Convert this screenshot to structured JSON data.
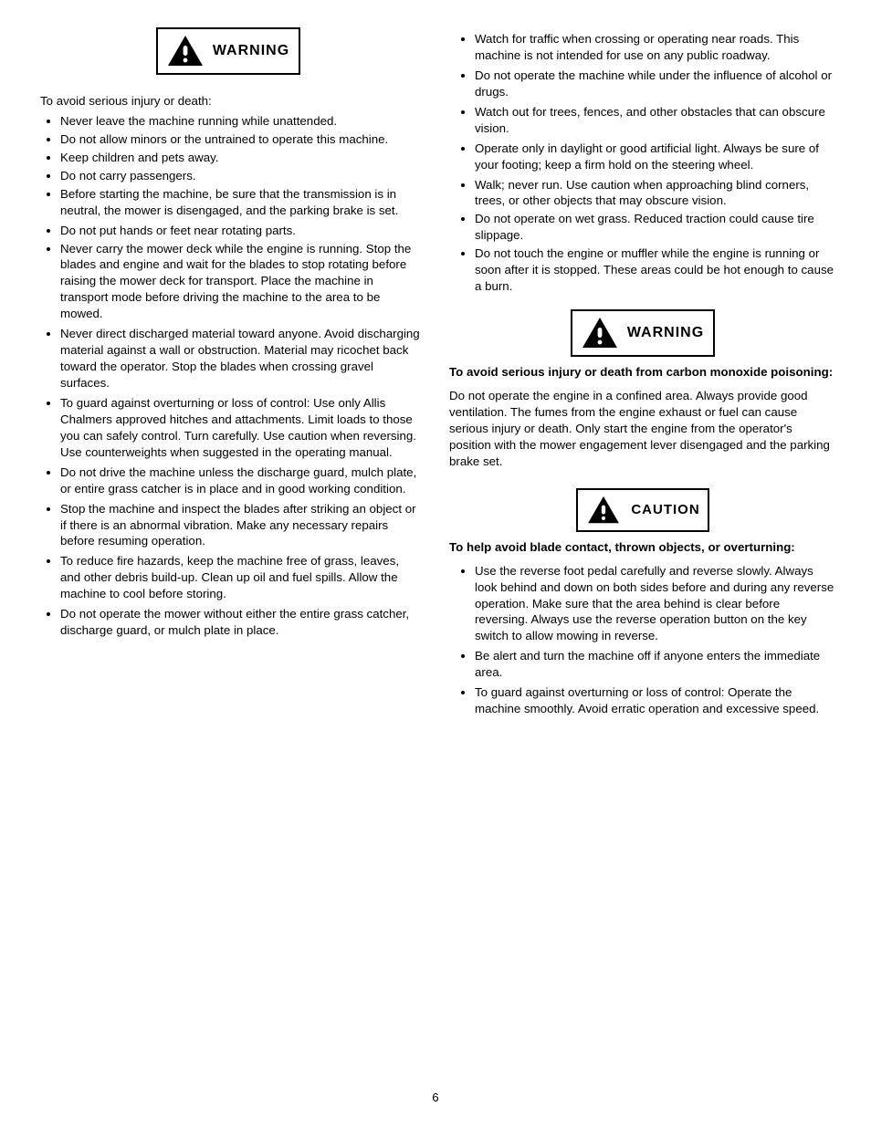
{
  "left": {
    "warning_label": "WARNING",
    "intro": "To avoid serious injury or death:",
    "group1": [
      "Never leave the machine running while unattended.",
      "Do not allow minors or the untrained to operate this machine.",
      "Keep children and pets away.",
      "Do not carry passengers.",
      "Before starting the machine, be sure that the transmission is in neutral, the mower is disengaged, and the parking brake is set.",
      "Do not put hands or feet near rotating parts.",
      "Never carry the mower deck while the engine is running. Stop the blades and engine and wait for the blades to stop rotating before raising the mower deck for transport. Place the machine in transport mode before driving the machine to the area to be mowed.",
      "Never direct discharged material toward anyone. Avoid discharging material against a wall or obstruction. Material may ricochet back toward the operator. Stop the blades when crossing gravel surfaces.",
      "To guard against overturning or loss of control: Use only Allis Chalmers approved hitches and attachments. Limit loads to those you can safely control. Turn carefully. Use caution when reversing. Use counterweights when suggested in the operating manual.",
      "Do not drive the machine unless the discharge guard, mulch plate, or entire grass catcher is in place and in good working condition.",
      "Stop the machine and inspect the blades after striking an object or if there is an abnormal vibration. Make any necessary repairs before resuming operation.",
      "To reduce fire hazards, keep the machine free of grass, leaves, and other debris build-up. Clean up oil and fuel spills. Allow the machine to cool before storing.",
      "Do not operate the mower without either the entire grass catcher, discharge guard, or mulch plate in place."
    ]
  },
  "right": {
    "group_top": [
      "Watch for traffic when crossing or operating near roads. This machine is not intended for use on any public roadway.",
      "Do not operate the machine while under the influence of alcohol or drugs.",
      "Watch out for trees, fences, and other obstacles that can obscure vision.",
      "Operate only in daylight or good artificial light. Always be sure of your footing; keep a firm hold on the steering wheel.",
      "Walk; never run. Use caution when approaching blind corners, trees, or other objects that may obscure vision.",
      "Do not operate on wet grass. Reduced traction could cause tire slippage.",
      "Do not touch the engine or muffler while the engine is running or soon after it is stopped. These areas could be hot enough to cause a burn."
    ],
    "warning2_label": "WARNING",
    "warning2_intro": "To avoid serious injury or death from carbon monoxide poisoning:",
    "warning2_para": "Do not operate the engine in a confined area. Always provide good ventilation. The fumes from the engine exhaust or fuel can cause serious injury or death. Only start the engine from the operator's position with the mower engagement lever disengaged and the parking brake set.",
    "caution_label": "CAUTION",
    "caution_intro": "To help avoid blade contact, thrown objects, or overturning:",
    "caution_group": [
      "Use the reverse foot pedal carefully and reverse slowly. Always look behind and down on both sides before and during any reverse operation. Make sure that the area behind is clear before reversing. Always use the reverse operation button on the key switch to allow mowing in reverse.",
      "Be alert and turn the machine off if anyone enters the immediate area.",
      "To guard against overturning or loss of control: Operate the machine smoothly. Avoid erratic operation and excessive speed."
    ]
  },
  "page_number": "6"
}
